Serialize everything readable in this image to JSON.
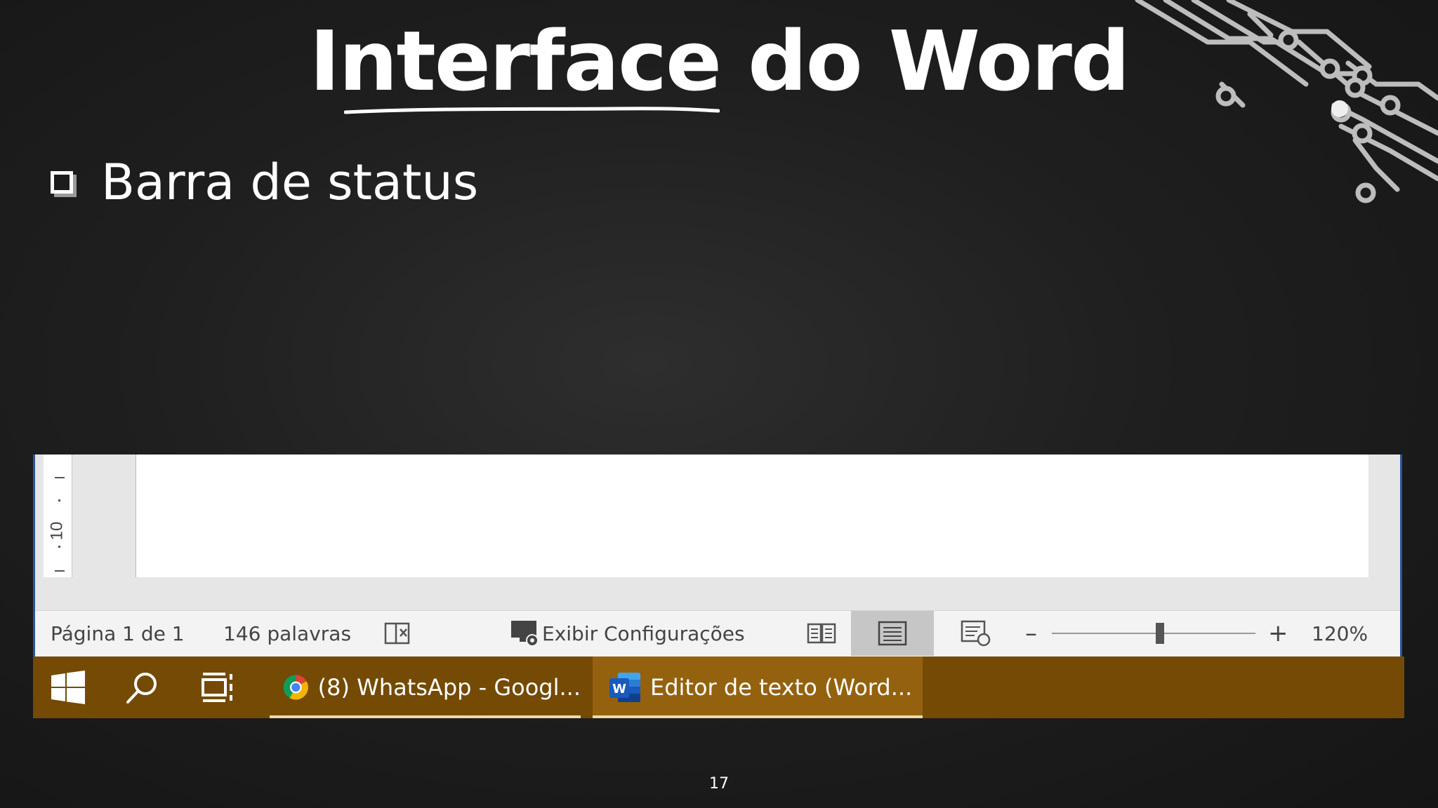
{
  "slide": {
    "title": "Interface do Word",
    "bullet": "Barra de status",
    "page_number": "17"
  },
  "word": {
    "ruler": {
      "label": "10"
    },
    "statusbar": {
      "page": "Página 1 de 1",
      "words": "146 palavras",
      "display_settings": "Exibir Configurações",
      "zoom_level": "120%",
      "zoom_minus": "–",
      "zoom_plus": "+"
    }
  },
  "taskbar": {
    "apps": [
      {
        "label": "(8) WhatsApp - Googl...",
        "icon": "chrome-icon"
      },
      {
        "label": "Editor de texto (Word...",
        "icon": "word-icon"
      }
    ],
    "color": "#744a05"
  },
  "colors": {
    "word_accent": "#2b579a",
    "background": "#1e1e1e"
  }
}
